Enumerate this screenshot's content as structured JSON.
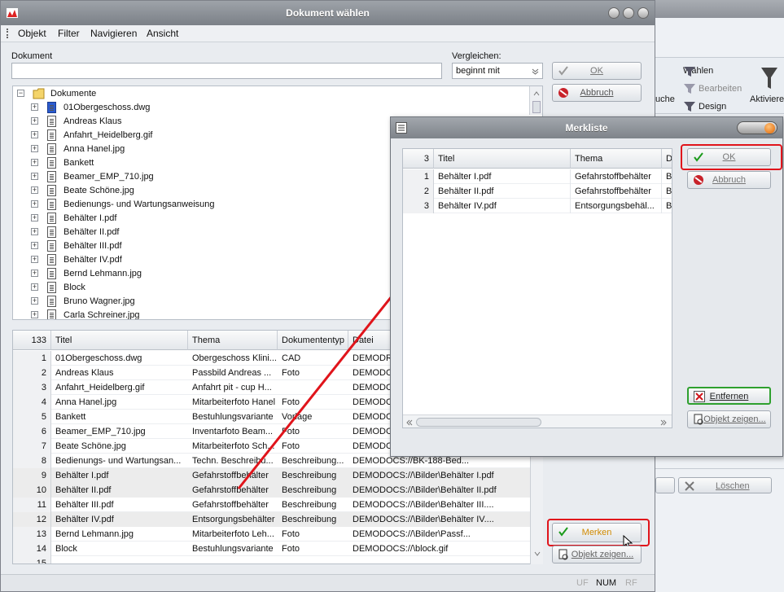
{
  "background_app": {
    "ribbon": {
      "waehlen": "Wählen",
      "bearbeiten": "Bearbeiten",
      "design": "Design",
      "suche": "uche",
      "aktivieren": "Aktiviere"
    },
    "loeschen": "Löschen"
  },
  "main_window": {
    "title": "Dokument wählen",
    "menu": [
      "Objekt",
      "Filter",
      "Navigieren",
      "Ansicht"
    ],
    "dokument_label": "Dokument",
    "dokument_value": "",
    "vergleichen_label": "Vergleichen:",
    "vergleichen_value": "beginnt mit",
    "ok_label": "OK",
    "abbruch_label": "Abbruch",
    "tree": {
      "root": "Dokumente",
      "items": [
        "01Obergeschoss.dwg",
        "Andreas Klaus",
        "Anfahrt_Heidelberg.gif",
        "Anna Hanel.jpg",
        "Bankett",
        "Beamer_EMP_710.jpg",
        "Beate Schöne.jpg",
        "Bedienungs- und Wartungsanweisung",
        "Behälter I.pdf",
        "Behälter II.pdf",
        "Behälter III.pdf",
        "Behälter IV.pdf",
        "Bernd Lehmann.jpg",
        "Block",
        "Bruno Wagner.jpg",
        "Carla Schreiner.jpg"
      ]
    },
    "grid": {
      "count": "133",
      "headers": [
        "Titel",
        "Thema",
        "Dokumententyp",
        "Datei"
      ],
      "rows": [
        {
          "n": "1",
          "titel": "01Obergeschoss.dwg",
          "thema": "Obergeschoss Klini...",
          "typ": "CAD",
          "datei": "DEMODR",
          "sel": false
        },
        {
          "n": "2",
          "titel": "Andreas Klaus",
          "thema": "Passbild Andreas ...",
          "typ": "Foto",
          "datei": "DEMODO",
          "sel": false
        },
        {
          "n": "3",
          "titel": "Anfahrt_Heidelberg.gif",
          "thema": "Anfahrt pit - cup H...",
          "typ": "",
          "datei": "DEMODO",
          "sel": false
        },
        {
          "n": "4",
          "titel": "Anna Hanel.jpg",
          "thema": "Mitarbeiterfoto Hanel",
          "typ": "Foto",
          "datei": "DEMODO",
          "sel": false
        },
        {
          "n": "5",
          "titel": "Bankett",
          "thema": "Bestuhlungsvariante",
          "typ": "Vorlage",
          "datei": "DEMODO",
          "sel": false
        },
        {
          "n": "6",
          "titel": "Beamer_EMP_710.jpg",
          "thema": "Inventarfoto Beam...",
          "typ": "Foto",
          "datei": "DEMODO",
          "sel": false
        },
        {
          "n": "7",
          "titel": "Beate Schöne.jpg",
          "thema": "Mitarbeiterfoto Sch...",
          "typ": "Foto",
          "datei": "DEMODO",
          "sel": false
        },
        {
          "n": "8",
          "titel": "Bedienungs- und Wartungsan...",
          "thema": "Techn. Beschreibu...",
          "typ": "Beschreibung...",
          "datei": "DEMODOCS://BK-188-Bed...",
          "sel": false
        },
        {
          "n": "9",
          "titel": "Behälter I.pdf",
          "thema": "Gefahrstoffbehälter",
          "typ": "Beschreibung",
          "datei": "DEMODOCS://\\Bilder\\Behälter I.pdf",
          "sel": true
        },
        {
          "n": "10",
          "titel": "Behälter II.pdf",
          "thema": "Gefahrstoffbehälter",
          "typ": "Beschreibung",
          "datei": "DEMODOCS://\\Bilder\\Behälter II.pdf",
          "sel": true
        },
        {
          "n": "11",
          "titel": "Behälter III.pdf",
          "thema": "Gefahrstoffbehälter",
          "typ": "Beschreibung",
          "datei": "DEMODOCS://\\Bilder\\Behälter III....",
          "sel": false
        },
        {
          "n": "12",
          "titel": "Behälter IV.pdf",
          "thema": "Entsorgungsbehälter",
          "typ": "Beschreibung",
          "datei": "DEMODOCS://\\Bilder\\Behälter IV....",
          "sel": true
        },
        {
          "n": "13",
          "titel": "Bernd Lehmann.jpg",
          "thema": "Mitarbeiterfoto Leh...",
          "typ": "Foto",
          "datei": "DEMODOCS://\\Bilder\\Passf...",
          "sel": false
        },
        {
          "n": "14",
          "titel": "Block",
          "thema": "Bestuhlungsvariante",
          "typ": "Foto",
          "datei": "DEMODOCS://\\block.gif",
          "sel": false
        },
        {
          "n": "15",
          "titel": "",
          "thema": "",
          "typ": "",
          "datei": "",
          "sel": false
        }
      ]
    },
    "merken_label": "Merken",
    "objekt_zeigen_label": "Objekt zeigen...",
    "status": {
      "uf": "UF",
      "num": "NUM",
      "rf": "RF"
    }
  },
  "merkliste": {
    "title": "Merkliste",
    "count": "3",
    "headers": [
      "Titel",
      "Thema",
      "D"
    ],
    "rows": [
      {
        "n": "1",
        "titel": "Behälter I.pdf",
        "thema": "Gefahrstoffbehälter",
        "d": "B"
      },
      {
        "n": "2",
        "titel": "Behälter II.pdf",
        "thema": "Gefahrstoffbehälter",
        "d": "B"
      },
      {
        "n": "3",
        "titel": "Behälter IV.pdf",
        "thema": "Entsorgungsbehäl...",
        "d": "B"
      }
    ],
    "ok_label": "OK",
    "abbruch_label": "Abbruch",
    "entfernen_label": "Entfernen",
    "objekt_zeigen_label": "Objekt zeigen..."
  },
  "colors": {
    "highlight": "#e0141b",
    "merken_text": "#d08a00",
    "check": "#1a9a1a"
  }
}
